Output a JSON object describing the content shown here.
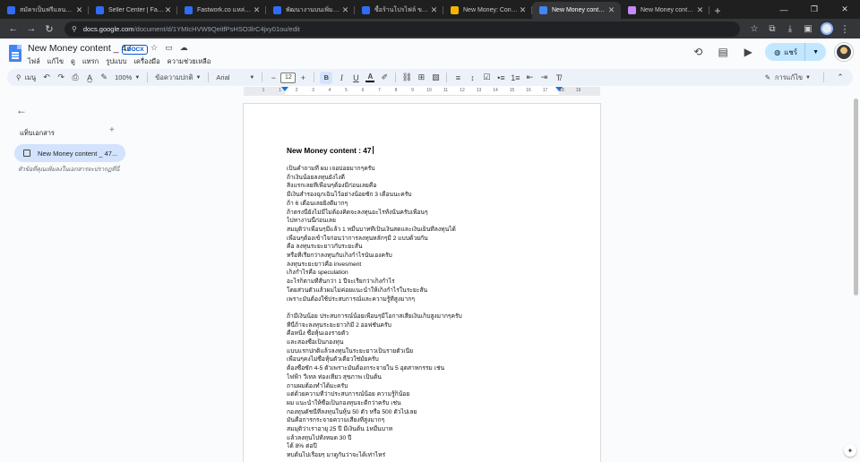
{
  "browser": {
    "tabs": [
      {
        "label": "สมัครเป็นฟรีแลนซ์ มีสปอยเลอ",
        "favicon_color": "#2f6df6"
      },
      {
        "label": "Seller Center | Fastwork.co",
        "favicon_color": "#2f6df6"
      },
      {
        "label": "Fastwork.co แหล่งรวมฟรีแลน",
        "favicon_color": "#2f6df6"
      },
      {
        "label": "พัฒนางานบนเพิ่มแล้วที่พ้นการค้",
        "favicon_color": "#2f6df6"
      },
      {
        "label": "ซื้อร้านโปรไฟล์ ของขั้นทุกอาชีพ",
        "favicon_color": "#2f6df6"
      },
      {
        "label": "New Money: Content 47",
        "favicon_color": "#f4b400"
      },
      {
        "label": "New Money content _47...",
        "favicon_color": "#4285f4"
      },
      {
        "label": "New Money content : 47",
        "favicon_color": "#c58af9"
      }
    ],
    "active_tab_index": 6,
    "new_tab": "+",
    "url_host": "docs.google.com",
    "url_path": "/document/d/1YMIcHVW9QeitfPsHSO3lrC4jxy01ou/edit"
  },
  "docs": {
    "title": "New Money content _ 47",
    "badge": ".DOCX",
    "menu": [
      "ไฟล์",
      "แก้ไข",
      "ดู",
      "แทรก",
      "รูปแบบ",
      "เครื่องมือ",
      "ความช่วยเหลือ"
    ],
    "share_label": "แชร์",
    "toolbar": {
      "search": "เมนู",
      "zoom": "100%",
      "style": "ข้อความปกติ",
      "font": "Arial",
      "font_size": "12",
      "editing_mode": "การแก้ไข"
    },
    "ruler_numbers": [
      "1",
      "1",
      "2",
      "3",
      "4",
      "5",
      "6",
      "7",
      "8",
      "9",
      "10",
      "11",
      "12",
      "13",
      "14",
      "15",
      "16",
      "17",
      "18",
      "19"
    ],
    "outline": {
      "tabs_label": "แท็บเอกสาร",
      "add": "+",
      "active_tab": "New Money content _ 47...",
      "hint": "หัวข้อที่คุณเพิ่มลงในเอกสารจะปรากฏที่นี่"
    }
  },
  "document": {
    "heading": "New Money content : 47",
    "lines": [
      "เป็นคำถามที่ ผม เจอบ่อยมากๆครับ",
      "ถ้าเงินน้อยลงทุนยังไงดี",
      "สิ่งแรกเลยที่เพื่อนๆต้องมีก่อนเลยคือ",
      "มีเงินสำรองฉุกเฉินไว้อย่างน้อยซัก 3 เดือนนะครับ",
      "ถ้า 6 เดือนเลยยิ่งดีมากๆ",
      "ถ้าตรงนี้ยังไม่มีไม่ต้องคิดจะลงทุนอะไรทั้งนั้นครับเพื่อนๆ",
      "ไปหางานนี้ก่อนเลย",
      "สมมุติว่าเพื่อนๆมีแล้ว 1 หมื่นบาทที่เป็นเงินสดและเงินเย็นที่ลงทุนได้",
      "เพื่อนๆต้องเข้าใจก่อนว่าการลงทุนหลักๆมี 2 แบบด้วยกัน",
      "คือ ลงทุนระยะยาวกับระยะสั้น",
      "หรือที่เรียกว่าลงทุนกับเก็งกำไรนั่นเองครับ",
      "ลงทุนระยะยาวคือ invesment",
      "เก็งกำไรคือ speculation",
      "อะไรก็ตามที่สั้นกว่า 1 ปีจะเรียกว่าเก็งกำไร",
      "โดยส่วนตัวแล้วผมไม่ค่อยแนะนำให้เก็งกำไรในระยะสั้น",
      "เพราะมันต้องใช้ประสบการณ์และความรู้ที่สูงมากๆ",
      "",
      "ถ้ามีเงินน้อย ประสบการณ์น้อยเพื่อนๆมีโอกาสเสียเงินเก็บสูงมากๆครับ",
      "ที่นี้ถ้าจะลงทุนระยะยาวก็มี 2 ออฟชั่นครับ",
      "คือหนึ่ง ซื้อหุ้นเองรายตัว",
      "และสองซื้อเป็นกองทุน",
      "แบบแรกปกติแล้วลงทุนในระยะยาวเป็นรายตัวเนี่ย",
      "เพื่อนๆคงไม่ซื้อหุ้นตัวเดียวใช่มั้ยครับ",
      "ต้องซื้อซัก 4-5 ตัวเพราะมันต้องกระจายใน 5 อุตสาหกรรม เช่น",
      "ไฟฟ้า วีเทล ท่องเที่ยว สุขภาพ เป็นต้น",
      "ถามผมต้องทำได้มะครับ",
      "แต่ด้วยความที่ว่าประสบการณ์น้อย ความรู้ก็น้อย",
      "ผม แนะนำให้ซื้อเป็นกองทุนจะดีกว่าครับ เช่น",
      "กองทุนดัชนีที่ลงทุนในหุ้น 50 ตัว หรือ 500 ตัวไปเลย",
      "มันคือการกระจายความเสี่ยงที่สูงมากๆ",
      "สมมุติว่าเราอายุ 25 ปี มีเงินต้น 1หมื่นบาท",
      "แล้วลงทุนไปทั้งหมด 30 ปี",
      "ได้ 8% ต่อปี",
      "ทบต้นไปเรื่อยๆ มาดูกันว่าจะได้เท่าไหร่"
    ]
  }
}
